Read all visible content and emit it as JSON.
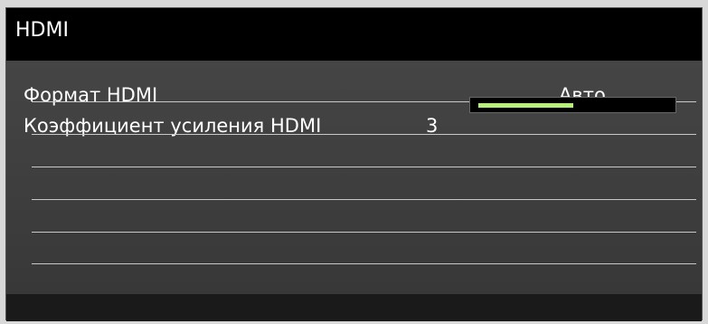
{
  "window": {
    "title": "HDMI"
  },
  "settings": [
    {
      "label": "Формат HDMI",
      "value": "Авто"
    },
    {
      "label": "Коэффициент усиления HDMI",
      "value": "3",
      "level_fraction": 0.5
    }
  ],
  "colors": {
    "panel": "#404040",
    "slider_fill": "#b6f07a",
    "text": "#ffffff"
  }
}
